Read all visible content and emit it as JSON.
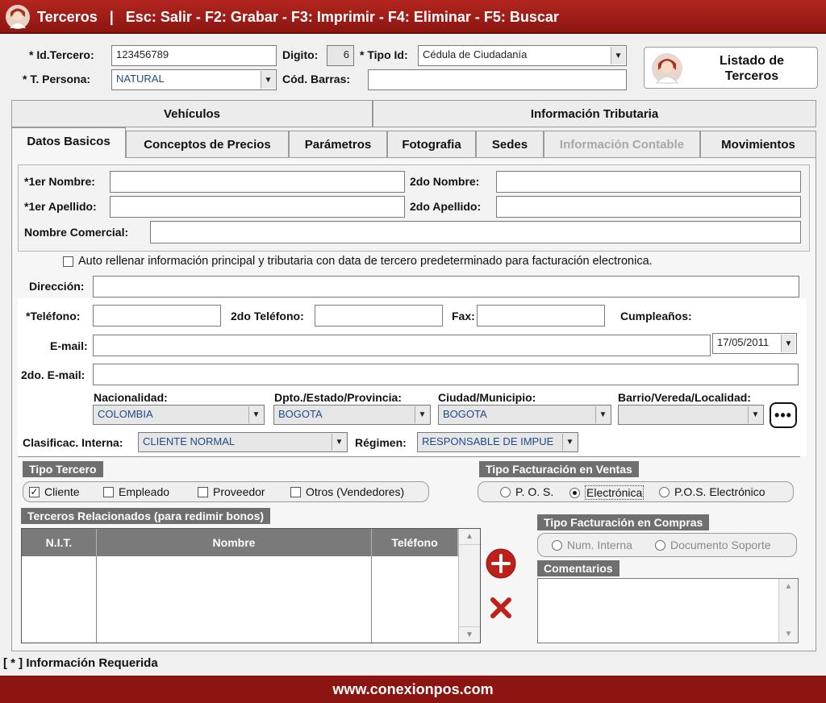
{
  "window": {
    "title_app": "Terceros",
    "title_separator": "|",
    "title_shortcuts": "Esc: Salir - F2: Grabar - F3: Imprimir - F4: Eliminar - F5: Buscar"
  },
  "header": {
    "id_tercero_label": "* Id.Tercero:",
    "id_tercero_value": "123456789",
    "digito_label": "Digito:",
    "digito_value": "6",
    "tipo_id_label": "* Tipo Id:",
    "tipo_id_value": "Cédula de Ciudadanía",
    "t_persona_label": "* T. Persona:",
    "t_persona_value": "NATURAL",
    "cod_barras_label": "Cód. Barras:",
    "cod_barras_value": "",
    "listado_button": "Listado de Terceros"
  },
  "tabs_top": [
    "Vehículos",
    "Información Tributaria"
  ],
  "tabs": [
    {
      "label": "Datos Basicos",
      "state": "active"
    },
    {
      "label": "Conceptos de Precios",
      "state": "normal"
    },
    {
      "label": "Parámetros",
      "state": "normal"
    },
    {
      "label": "Fotografia",
      "state": "normal"
    },
    {
      "label": "Sedes",
      "state": "normal"
    },
    {
      "label": "Información Contable",
      "state": "disabled"
    },
    {
      "label": "Movimientos",
      "state": "normal"
    }
  ],
  "form": {
    "primer_nombre_label": "*1er Nombre:",
    "segundo_nombre_label": "2do Nombre:",
    "primer_apellido_label": "*1er Apellido:",
    "segundo_apellido_label": "2do Apellido:",
    "nombre_comercial_label": "Nombre Comercial:",
    "auto_rellenar_label": "Auto rellenar información principal y tributaria con data de tercero predeterminado para facturación electronica.",
    "direccion_label": "Dirección:",
    "telefono_label": "*Teléfono:",
    "segundo_telefono_label": "2do Teléfono:",
    "fax_label": "Fax:",
    "cumpleanos_label": "Cumpleaños:",
    "cumpleanos_value": "17/05/2011",
    "email_label": "E-mail:",
    "segundo_email_label": "2do. E-mail:",
    "nacionalidad_label": "Nacionalidad:",
    "nacionalidad_value": "COLOMBIA",
    "dpto_label": "Dpto./Estado/Provincia:",
    "dpto_value": "BOGOTA",
    "ciudad_label": "Ciudad/Municipio:",
    "ciudad_value": "BOGOTA",
    "barrio_label": "Barrio/Vereda/Localidad:",
    "barrio_value": "",
    "clasificacion_label": "Clasificac. Interna:",
    "clasificacion_value": "CLIENTE NORMAL",
    "regimen_label": "Régimen:",
    "regimen_value": "RESPONSABLE DE IMPUE"
  },
  "tipo_tercero": {
    "title": "Tipo Tercero",
    "options": [
      {
        "label": "Cliente",
        "checked": true
      },
      {
        "label": "Empleado",
        "checked": false
      },
      {
        "label": "Proveedor",
        "checked": false
      },
      {
        "label": "Otros (Vendedores)",
        "checked": false
      }
    ]
  },
  "facturacion_ventas": {
    "title": "Tipo Facturación en Ventas",
    "options": [
      {
        "label": "P. O. S.",
        "selected": false
      },
      {
        "label": "Electrónica",
        "selected": true
      },
      {
        "label": "P.O.S. Electrónico",
        "selected": false
      }
    ]
  },
  "relacionados": {
    "title": "Terceros Relacionados (para redimir bonos)",
    "columns": [
      "N.I.T.",
      "Nombre",
      "Teléfono"
    ],
    "rows": []
  },
  "facturacion_compras": {
    "title": "Tipo Facturación en Compras",
    "options": [
      {
        "label": "Num. Interna",
        "selected": false
      },
      {
        "label": "Documento Soporte",
        "selected": false
      }
    ]
  },
  "comentarios": {
    "title": "Comentarios",
    "value": ""
  },
  "required_note": "[ * ] Información Requerida",
  "footer_url": "www.conexionpos.com",
  "colors": {
    "brand": "#8c1512",
    "accent_red": "#c0201a"
  }
}
